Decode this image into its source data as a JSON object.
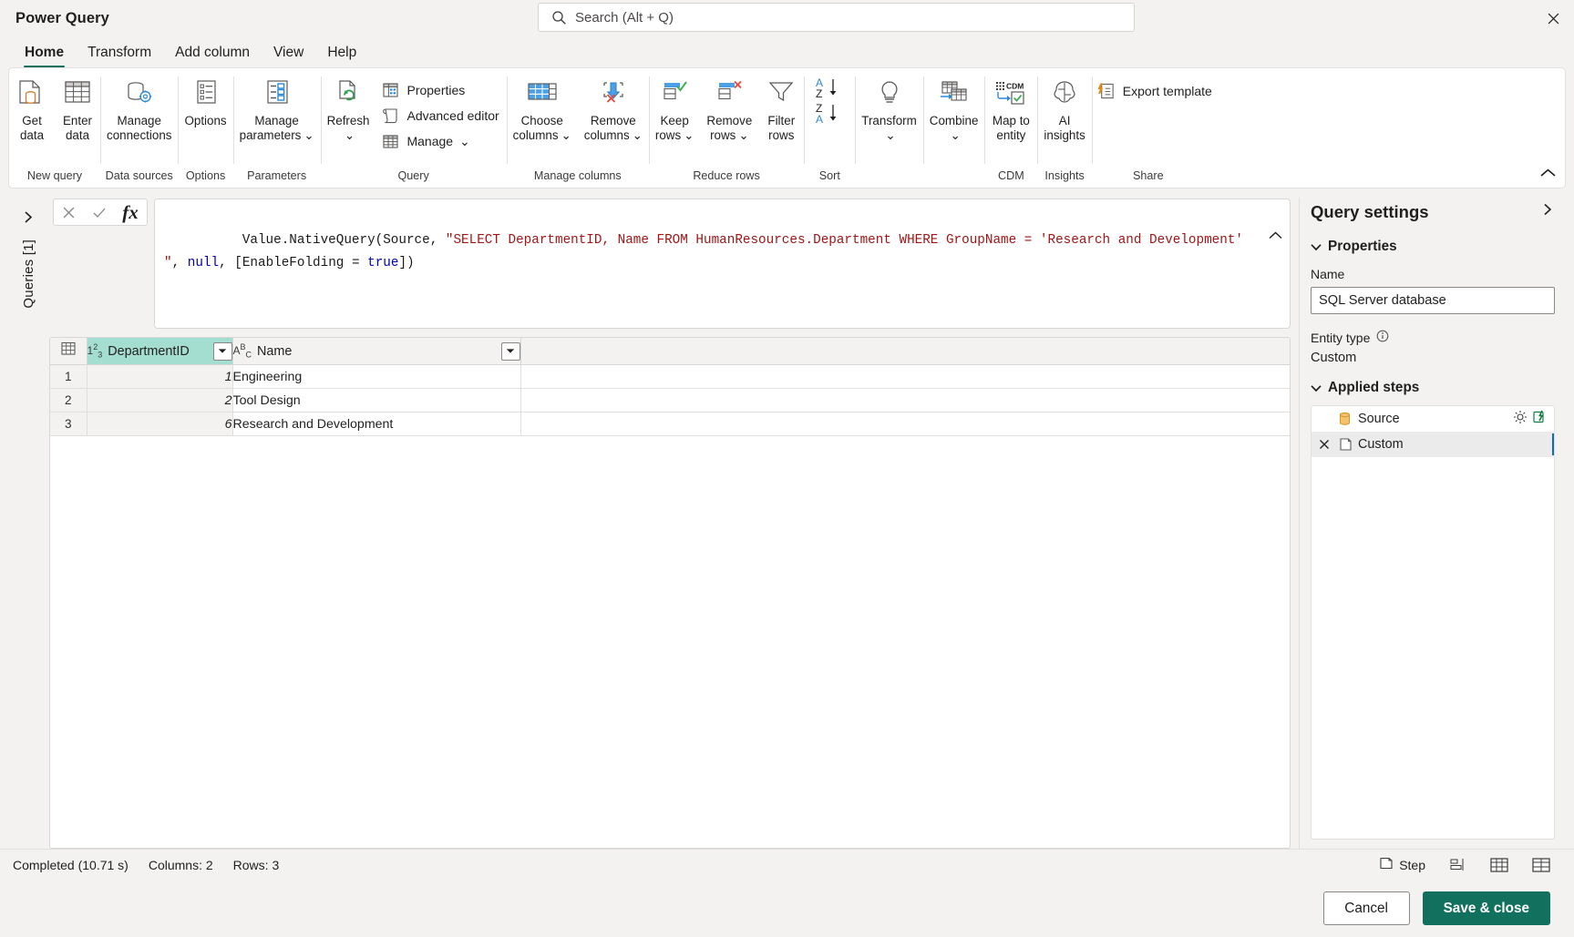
{
  "window": {
    "app_title": "Power Query",
    "close_label": "✕"
  },
  "search": {
    "placeholder": "Search (Alt + Q)",
    "value": ""
  },
  "ribbon_tabs": [
    {
      "label": "Home",
      "active": true
    },
    {
      "label": "Transform",
      "active": false
    },
    {
      "label": "Add column",
      "active": false
    },
    {
      "label": "View",
      "active": false
    },
    {
      "label": "Help",
      "active": false
    }
  ],
  "ribbon_groups": [
    {
      "name": "New query",
      "label": "New query",
      "buttons": [
        {
          "label": "Get\ndata",
          "icon": "get-data-icon",
          "dropdown": true
        },
        {
          "label": "Enter\ndata",
          "icon": "enter-data-icon",
          "dropdown": false
        }
      ]
    },
    {
      "name": "Data sources",
      "label": "Data sources",
      "buttons": [
        {
          "label": "Manage\nconnections",
          "icon": "manage-connections-icon",
          "dropdown": false
        }
      ]
    },
    {
      "name": "Options",
      "label": "Options",
      "buttons": [
        {
          "label": "Options",
          "icon": "options-icon",
          "dropdown": false
        }
      ]
    },
    {
      "name": "Parameters",
      "label": "Parameters",
      "buttons": [
        {
          "label": "Manage\nparameters",
          "icon": "manage-parameters-icon",
          "dropdown": true
        }
      ]
    },
    {
      "name": "Query",
      "label": "Query",
      "buttons": [
        {
          "label": "Refresh",
          "icon": "refresh-icon",
          "dropdown": true
        }
      ],
      "small_buttons": [
        {
          "label": "Properties",
          "icon": "properties-icon",
          "dropdown": false
        },
        {
          "label": "Advanced editor",
          "icon": "advanced-editor-icon",
          "dropdown": false
        },
        {
          "label": "Manage",
          "icon": "manage-icon",
          "dropdown": true
        }
      ]
    },
    {
      "name": "Manage columns",
      "label": "Manage columns",
      "buttons": [
        {
          "label": "Choose\ncolumns",
          "icon": "choose-columns-icon",
          "dropdown": true
        },
        {
          "label": "Remove\ncolumns",
          "icon": "remove-columns-icon",
          "dropdown": true
        }
      ]
    },
    {
      "name": "Reduce rows",
      "label": "Reduce rows",
      "buttons": [
        {
          "label": "Keep\nrows",
          "icon": "keep-rows-icon",
          "dropdown": true
        },
        {
          "label": "Remove\nrows",
          "icon": "remove-rows-icon",
          "dropdown": true
        },
        {
          "label": "Filter\nrows",
          "icon": "filter-rows-icon",
          "dropdown": false
        }
      ]
    },
    {
      "name": "Sort",
      "label": "Sort",
      "buttons": [
        {
          "label": "",
          "icon": "sort-az-za-icon",
          "dropdown": false
        }
      ]
    },
    {
      "name": "Transform",
      "label": "",
      "buttons": [
        {
          "label": "Transform",
          "icon": "transform-bulb-icon",
          "dropdown": true
        }
      ]
    },
    {
      "name": "Combine",
      "label": "",
      "buttons": [
        {
          "label": "Combine",
          "icon": "combine-icon",
          "dropdown": true
        }
      ]
    },
    {
      "name": "CDM",
      "label": "CDM",
      "buttons": [
        {
          "label": "Map to\nentity",
          "icon": "map-to-entity-icon",
          "dropdown": false
        }
      ]
    },
    {
      "name": "Insights",
      "label": "Insights",
      "buttons": [
        {
          "label": "AI\ninsights",
          "icon": "ai-insights-icon",
          "dropdown": false
        }
      ]
    },
    {
      "name": "Share",
      "label": "Share",
      "small_buttons": [
        {
          "label": "Export template",
          "icon": "export-template-icon",
          "dropdown": false
        }
      ]
    }
  ],
  "queries_rail": {
    "label": "Queries [1]",
    "expand_icon": "chevron-right-icon"
  },
  "formula_bar": {
    "cancel_icon": "cancel-x-icon",
    "accept_icon": "accept-check-icon",
    "fx_label": "fx",
    "formula_segments": [
      {
        "text": "Value.NativeQuery(Source, ",
        "type": "plain"
      },
      {
        "text": "\"SELECT DepartmentID, Name FROM HumanResources.Department WHERE GroupName = 'Research and Development'  \"",
        "type": "string"
      },
      {
        "text": ", ",
        "type": "plain"
      },
      {
        "text": "null",
        "type": "keyword"
      },
      {
        "text": ", [EnableFolding = ",
        "type": "plain"
      },
      {
        "text": "true",
        "type": "keyword"
      },
      {
        "text": "])",
        "type": "plain"
      }
    ],
    "collapse_icon": "chevron-up-icon"
  },
  "grid": {
    "columns": [
      {
        "name": "DepartmentID",
        "type_glyph": "123",
        "type": "number",
        "selected": true,
        "has_filter": true
      },
      {
        "name": "Name",
        "type_glyph": "ABC",
        "type": "text",
        "selected": false,
        "has_filter": true
      }
    ],
    "rows": [
      {
        "num": "1",
        "DepartmentID": "1",
        "Name": "Engineering"
      },
      {
        "num": "2",
        "DepartmentID": "2",
        "Name": "Tool Design"
      },
      {
        "num": "3",
        "DepartmentID": "6",
        "Name": "Research and Development"
      }
    ]
  },
  "query_settings": {
    "title": "Query settings",
    "collapse_icon": "chevron-right-icon",
    "properties_section": "Properties",
    "name_label": "Name",
    "name_value": "SQL Server database",
    "entity_type_label": "Entity type",
    "entity_type_info_icon": "info-icon",
    "entity_type_value": "Custom",
    "applied_steps_section": "Applied steps",
    "steps": [
      {
        "label": "Source",
        "icon": "database-icon",
        "selected": false,
        "deletable": false,
        "gear": true,
        "folding": true
      },
      {
        "label": "Custom",
        "icon": "custom-step-icon",
        "selected": true,
        "deletable": true,
        "gear": false,
        "folding": false
      }
    ]
  },
  "status_bar": {
    "completed": "Completed (10.71 s)",
    "columns": "Columns: 2",
    "rows": "Rows: 3",
    "step_label": "Step",
    "step_icon": "step-icon",
    "profile_icon": "column-profile-icon",
    "table_view_icon": "table-view-icon",
    "schema_view_icon": "schema-view-icon"
  },
  "footer": {
    "cancel_label": "Cancel",
    "save_label": "Save & close"
  },
  "colors": {
    "accent": "#12715e",
    "selected_column": "#a4ded0",
    "string": "#a31515",
    "keyword": "#0000c0"
  }
}
